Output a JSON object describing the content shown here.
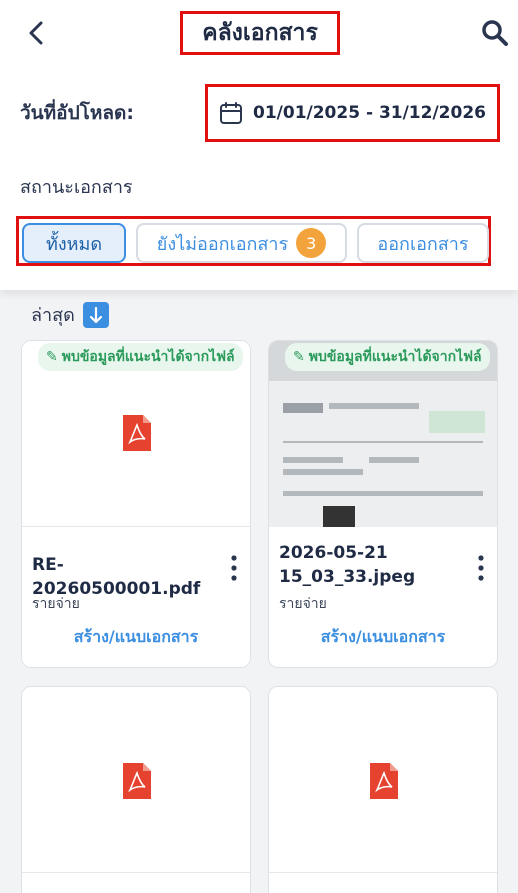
{
  "header": {
    "title": "คลังเอกสาร",
    "back_icon": "chevron-left-icon",
    "search_icon": "search-icon"
  },
  "filters": {
    "upload_date_label": "วันที่อัปโหลด:",
    "date_range": "01/01/2025 - 31/12/2026",
    "status_label": "สถานะเอกสาร",
    "chips": [
      {
        "label": "ทั้งหมด",
        "active": true
      },
      {
        "label": "ยังไม่ออกเอกสาร",
        "count": "3"
      },
      {
        "label": "ออกเอกสาร"
      }
    ]
  },
  "sort": {
    "label": "ล่าสุด",
    "direction_icon": "arrow-down-icon"
  },
  "documents": [
    {
      "ai_tag": "พบข้อมูลที่แนะนำได้จากไฟล์",
      "filename": "RE-20260500001.pdf",
      "category": "รายจ่าย",
      "action": "สร้าง/แนบเอกสาร"
    },
    {
      "ai_tag": "พบข้อมูลที่แนะนำได้จากไฟล์",
      "filename": "2026-05-21 15_03_33.jpeg",
      "category": "รายจ่าย",
      "action": "สร้าง/แนบเอกสาร"
    }
  ],
  "colors": {
    "accent": "#3b8ee0",
    "highlight": "#e01010",
    "badge": "#f3a33b",
    "ai_green": "#2a9a5a"
  }
}
